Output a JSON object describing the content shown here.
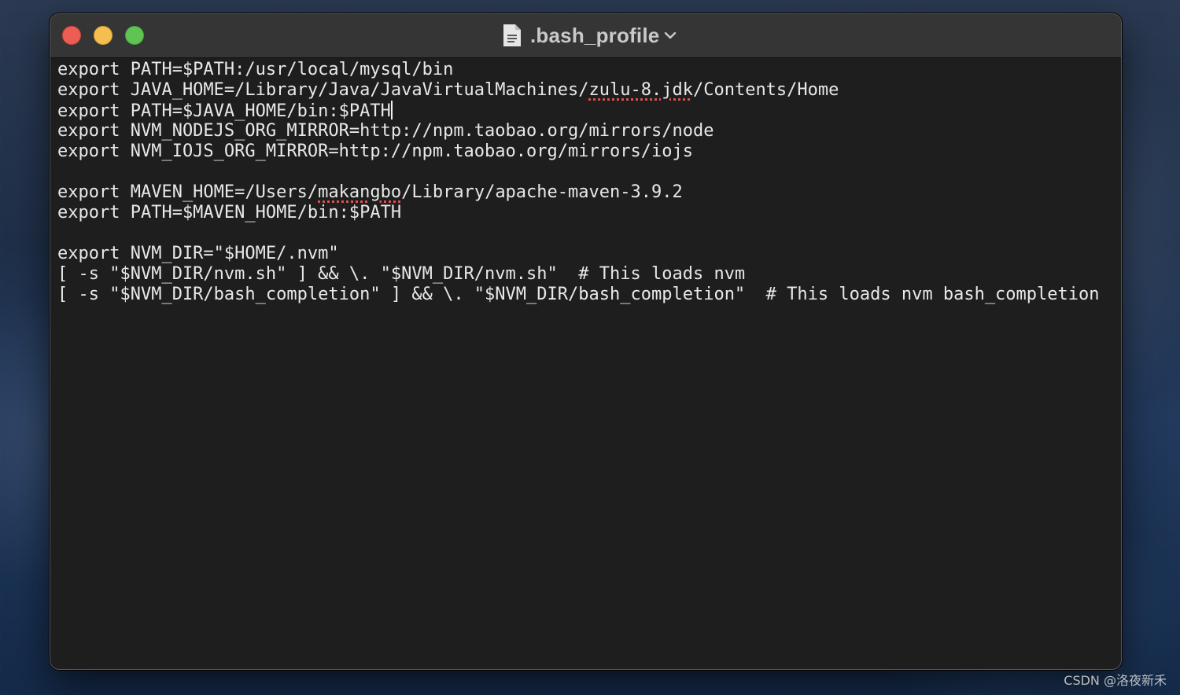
{
  "window": {
    "title": ".bash_profile",
    "file_icon": "document-icon",
    "title_menu_icon": "chevron-down-icon"
  },
  "editor": {
    "lines": [
      {
        "segments": [
          {
            "text": "export PATH=$PATH:/usr/local/mysql/bin"
          }
        ]
      },
      {
        "segments": [
          {
            "text": "export JAVA_HOME=/Library/Java/JavaVirtualMachines/"
          },
          {
            "text": "zulu-8.jdk",
            "spell": true
          },
          {
            "text": "/Contents/Home"
          }
        ]
      },
      {
        "segments": [
          {
            "text": "export PATH=$JAVA_HOME/bin:$PATH"
          }
        ],
        "caret": true
      },
      {
        "segments": [
          {
            "text": "export NVM_NODEJS_ORG_MIRROR=http://npm.taobao.org/mirrors/node"
          }
        ]
      },
      {
        "segments": [
          {
            "text": "export NVM_IOJS_ORG_MIRROR=http://npm.taobao.org/mirrors/iojs"
          }
        ]
      },
      {
        "segments": [
          {
            "text": ""
          }
        ]
      },
      {
        "segments": [
          {
            "text": "export MAVEN_HOME=/Users/"
          },
          {
            "text": "makangbo",
            "spell": true
          },
          {
            "text": "/Library/apache-maven-3.9.2"
          }
        ]
      },
      {
        "segments": [
          {
            "text": "export PATH=$MAVEN_HOME/bin:$PATH"
          }
        ]
      },
      {
        "segments": [
          {
            "text": ""
          }
        ]
      },
      {
        "segments": [
          {
            "text": "export NVM_DIR=\"$HOME/.nvm\""
          }
        ]
      },
      {
        "segments": [
          {
            "text": "[ -s \"$NVM_DIR/nvm.sh\" ] && \\. \"$NVM_DIR/nvm.sh\"  # This loads nvm"
          }
        ]
      },
      {
        "segments": [
          {
            "text": "[ -s \"$NVM_DIR/bash_completion\" ] && \\. \"$NVM_DIR/bash_completion\"  # This loads nvm bash_completion"
          }
        ]
      }
    ]
  },
  "watermark": "CSDN @洛夜新禾",
  "colors": {
    "close": "#ec5e54",
    "minimize": "#f4bf4f",
    "maximize": "#5fc454",
    "editor_background": "#1e1e1e",
    "titlebar": "#353535",
    "text": "#e8e8e8",
    "spell_underline": "#d9534f"
  }
}
